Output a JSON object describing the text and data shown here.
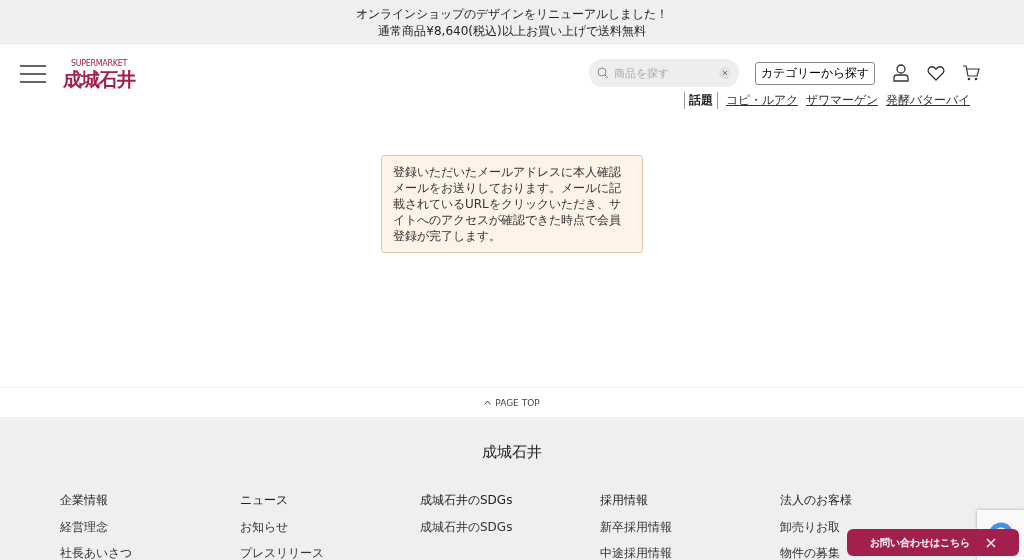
{
  "announcement": [
    "オンラインショップのデザインをリニューアルしました！",
    "通常商品¥8,640(税込)以上お買い上げで送料無料"
  ],
  "logo": {
    "tagline": "SUPERMARKET",
    "name": "成城石井"
  },
  "search": {
    "placeholder": "商品を探す"
  },
  "category_button": "カテゴリーから探す",
  "trending": {
    "label": "話題",
    "links": [
      "コピ・ルアク",
      "ザワマーゲン",
      "発酵バターバイ"
    ]
  },
  "message": "登録いただいたメールアドレスに本人確認メールをお送りしております。メールに記載されているURLをクリックいただき、サイトへのアクセスが確認できた時点で会員登録が完了します。",
  "page_top": "PAGE TOP",
  "footer": {
    "title": "成城石井",
    "columns": [
      {
        "heading": "企業情報",
        "links": [
          "経営理念",
          "社長あいさつ"
        ]
      },
      {
        "heading": "ニュース",
        "links": [
          "お知らせ",
          "プレスリリース"
        ]
      },
      {
        "heading": "成城石井のSDGs",
        "links": [
          "成城石井のSDGs"
        ]
      },
      {
        "heading": "採用情報",
        "links": [
          "新卒採用情報",
          "中途採用情報"
        ]
      },
      {
        "heading": "法人のお客様",
        "links": [
          "卸売りお取",
          "物件の募集"
        ]
      }
    ]
  },
  "contact_button": "お問い合わせはこちら"
}
